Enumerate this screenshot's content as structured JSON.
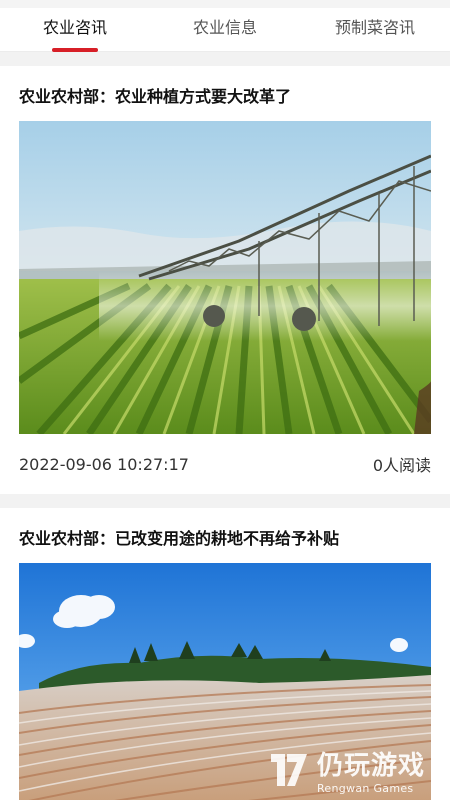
{
  "tabs": [
    {
      "label": "农业咨讯",
      "active": true
    },
    {
      "label": "农业信息",
      "active": false
    },
    {
      "label": "预制菜咨讯",
      "active": false
    }
  ],
  "colors": {
    "accent": "#d71f27"
  },
  "articles": [
    {
      "title": "农业农村部：农业种植方式要大改革了",
      "image": "center-pivot-irrigation-field",
      "datetime": "2022-09-06 10:27:17",
      "reads": "0人阅读"
    },
    {
      "title": "农业农村部：已改变用途的耕地不再给予补贴",
      "image": "plastic-mulch-farmland-hills"
    }
  ],
  "watermark": {
    "cn": "仍玩游戏",
    "en": "Rengwan Games"
  }
}
